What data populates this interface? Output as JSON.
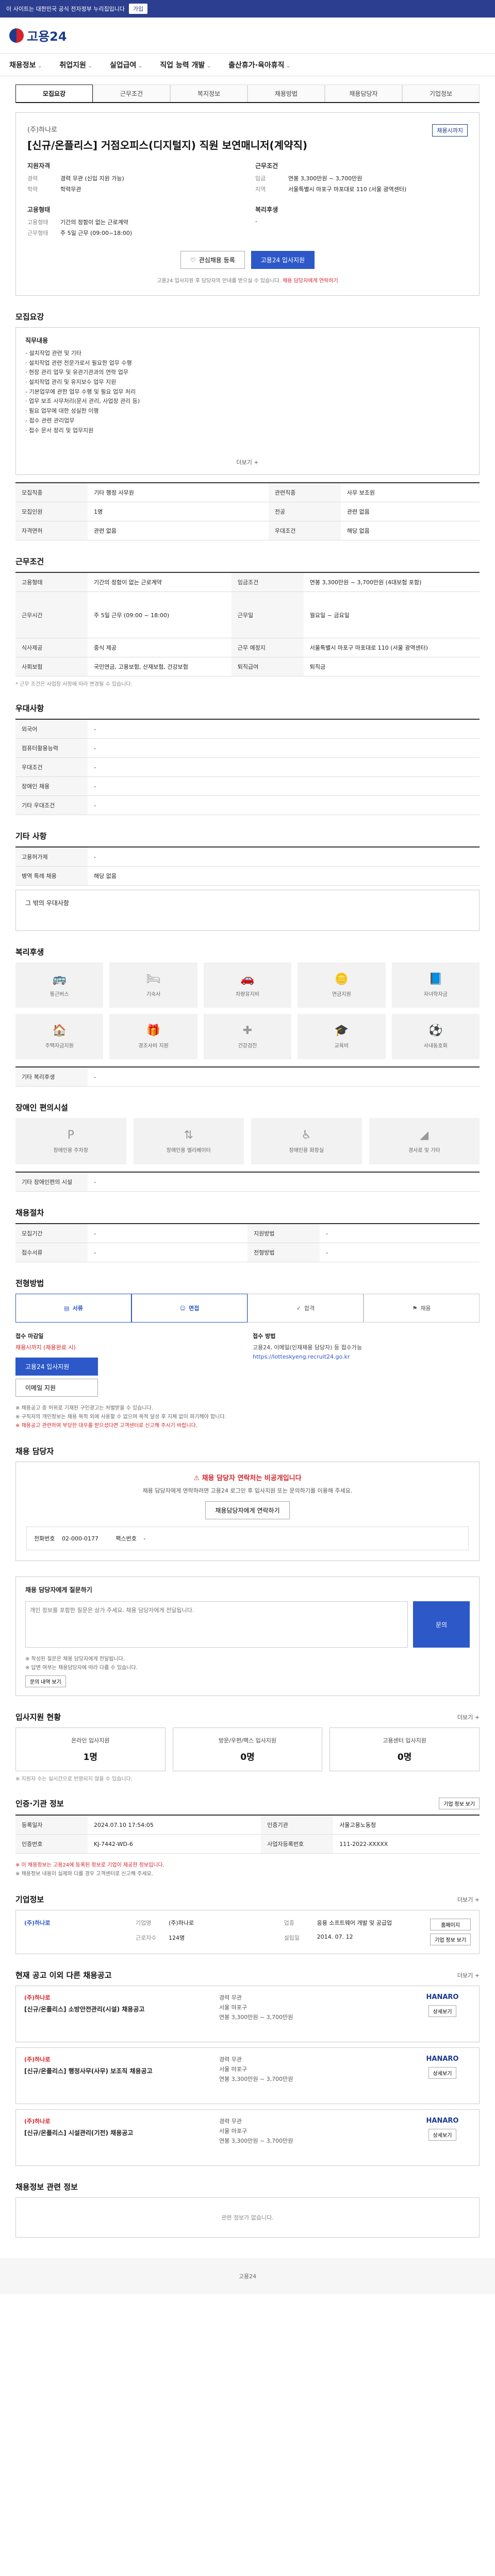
{
  "topbar": {
    "notice": "이 사이트는 대한민국 공식 전자정부 누리집입니다",
    "button": "가입"
  },
  "header": {
    "logo": "고용24"
  },
  "gnb": [
    "채용정보",
    "취업지원",
    "실업급여",
    "직업 능력 개발",
    "출산휴가·육아휴직"
  ],
  "sub_tabs": [
    "모집요강",
    "근무조건",
    "복지정보",
    "채용방법",
    "채용담당자",
    "기업정보"
  ],
  "headline": {
    "badge": "채용시까지",
    "company": "(주)하나로",
    "title": "[신규/온플리스] 거점오피스(디지털지) 직원 보연매니저(계약직)",
    "qual_title": "지원자격",
    "career_k": "경력",
    "career_v": "경력 무관 (신입 지원 가능)",
    "edu_k": "학력",
    "edu_v": "학력무관",
    "cond_title": "근무조건",
    "wage_k": "임금",
    "wage_v": "연봉 3,300만원 ~ 3,700만원",
    "region_k": "지역",
    "region_v": "서울특별시 마포구 마포대로 110 (서울 광역센터)",
    "type_title": "고용형태",
    "type_k": "고용형태",
    "type_v": "기간의 정함이 없는 근로계약",
    "hours_k": "근무형태",
    "hours_v": "주 5일 근무 (09:00~18:00)",
    "welfare_title": "복리후생",
    "welfare_v": "-",
    "btn_interest": "관심채용 등록",
    "btn_apply": "고용24 입사지원",
    "notice": "고용24 입사지원 후 담당자의 안내를 받으실 수 있습니다.",
    "notice_red": "채용 담당자에게 연락하기"
  },
  "detail": {
    "title": "모집요강",
    "heading": "직무내용",
    "body": "- 설치작업 관련 및 기타\n  · 설치작업 관련 전문가로서 필요한 업무 수행\n  · 현장 관리 업무 및 유관기관과의 연락 업무\n  · 설치작업 관리 및 유지보수 업무 지원\n- 기본업무에 관한 업무 수행 및 필요 업무 처리\n  · 업무 보조 사무처리(문서 관리, 사업장 관리 등)\n  · 필요 업무에 대한 성실한 이행\n- 접수 관련 관리업무\n  · 접수 문서 정리 및 업무지원",
    "more": "더보기 +",
    "rows": [
      {
        "k": "모집직종",
        "v": "기타 행정 사무원"
      },
      {
        "k": "관련직종",
        "v": "사무 보조원"
      },
      {
        "k": "모집인원",
        "v": "1명"
      },
      {
        "k": "전공",
        "v": "관련 없음"
      },
      {
        "k": "자격면허",
        "v": "관련 없음"
      },
      {
        "k": "우대조건",
        "v": "해당 없음"
      }
    ]
  },
  "conditions": {
    "title": "근무조건",
    "rows": [
      {
        "k": "고용형태",
        "v": "기간의 정함이 없는 근로계약"
      },
      {
        "k": "임금조건",
        "v": "연봉 3,300만원 ~ 3,700만원 (4대보험 포함)"
      },
      {
        "k": "근무시간",
        "v": "주 5일 근무 (09:00 ~ 18:00)"
      },
      {
        "k": "근무일",
        "v": "월요일 ~ 금요일"
      },
      {
        "k": "식사제공",
        "v": "중식 제공"
      },
      {
        "k": "근무 예정지",
        "v": "서울특별시 마포구 마포대로 110 (서울 광역센터)"
      },
      {
        "k": "사회보험",
        "v": "국민연금, 고용보험, 산재보험, 건강보험"
      },
      {
        "k": "퇴직급여",
        "v": "퇴직금"
      }
    ],
    "note": "* 근무 조건은 사업장 사정에 따라 변경될 수 있습니다."
  },
  "worker_info": {
    "title": "우대사항",
    "rows": [
      {
        "k": "외국어",
        "v": "-"
      },
      {
        "k": "컴퓨터활용능력",
        "v": "-"
      },
      {
        "k": "우대조건",
        "v": "-"
      },
      {
        "k": "장애인 채용",
        "v": "-"
      },
      {
        "k": "기타 우대조건",
        "v": "-"
      }
    ]
  },
  "other_info": {
    "title": "기타 사항",
    "rows": [
      {
        "k": "고용허가제",
        "v": "-"
      },
      {
        "k": "병역 특례 채용",
        "v": "해당 없음"
      }
    ],
    "extra_label": "그 밖의 우대사항"
  },
  "welfare": {
    "title": "복리후생",
    "items": [
      "통근버스",
      "기숙사",
      "차량유지비",
      "연금지원",
      "자녀학자금",
      "주택자금지원",
      "경조사비 지원",
      "건강검진",
      "교육비",
      "사내동호회"
    ],
    "etc_label": "기타 복리후생",
    "etc_value": "-"
  },
  "facility": {
    "title": "장애인 편의시설",
    "items": [
      "장애인용 주차장",
      "장애인용 엘리베이터",
      "장애인용 화장실",
      "경사로 및 기타"
    ],
    "etc_label": "기타 장애인편의 시설",
    "etc_value": "-"
  },
  "contract": {
    "title": "채용절차",
    "rows": [
      {
        "k": "모집기간",
        "v": "-"
      },
      {
        "k": "지원방법",
        "v": "-"
      },
      {
        "k": "접수서류",
        "v": "-"
      },
      {
        "k": "전형방법",
        "v": "-"
      }
    ]
  },
  "process": {
    "title": "전형방법",
    "steps": [
      "서류",
      "면접",
      "합격",
      "채용"
    ],
    "apply_label": "접수 마감일",
    "apply_value": "채용시까지 (채용완료 시)",
    "apply_btn": "고용24 입사지원",
    "apply_btn2": "이메일 지원",
    "method_label": "접수 방법",
    "method_value": "고용24, 이메일(인재채용 담당자) 등 접수가능",
    "method_link": "https://lotteskyeng.recruit24.go.kr",
    "notes": [
      "※ 채용공고 중 허위로 기재된 구인광고는 처벌받을 수 있습니다.",
      "※ 구직자의 개인정보는 채용 목적 외에 사용할 수 없으며 목적 달성 후 지체 없이 파기해야 합니다.",
      "※ 채용공고 관련하여 부당한 대우를 받으셨다면 고객센터로 신고해 주시기 바랍니다."
    ]
  },
  "contact": {
    "title": "채용 담당자",
    "warn": "채용 담당자 연락처는 비공개입니다",
    "desc": "채용 담당자에게 연락하려면 고용24 로그인 후 입사지원 또는 문의하기를 이용해 주세요.",
    "btn": "채용담당자에게 연락하기",
    "phone_label": "전화번호",
    "phone": "02-000-0177",
    "fax_label": "팩스번호",
    "fax": "-"
  },
  "inquiry": {
    "title": "채용 담당자에게 질문하기",
    "placeholder": "개인 정보를 포함한 질문은 삼가 주세요. 채용 담당자에게 전달됩니다.",
    "btn": "문의",
    "notes": [
      "※ 작성된 질문은 채용 담당자에게 전달됩니다.",
      "※ 답변 여부는 채용담당자에 따라 다를 수 있습니다."
    ],
    "note_btn": "문의 내역 보기"
  },
  "status": {
    "title": "입사지원 현황",
    "more": "더보기 +",
    "cards": [
      {
        "label": "온라인 입사지원",
        "value": "1명"
      },
      {
        "label": "방문/우편/팩스 입사지원",
        "value": "0명"
      },
      {
        "label": "고용센터 입사지원",
        "value": "0명"
      }
    ],
    "note": "※ 지원자 수는 실시간으로 반영되지 않을 수 있습니다."
  },
  "recruiter": {
    "title": "인증·기관 정보",
    "btn": "기업 정보 보기",
    "rows": [
      {
        "k1": "등록일자",
        "v1": "2024.07.10 17:54:05",
        "k2": "인증기관",
        "v2": "서울고용노동청"
      },
      {
        "k1": "인증번호",
        "v1": "KJ-7442-WD-6",
        "k2": "사업자등록번호",
        "v2": "111-2022-XXXXX"
      }
    ],
    "notes": [
      "※ 이 채용정보는 고용24에 등록된 정보로 기업이 제공한 정보입니다.",
      "※ 채용정보 내용이 실제와 다를 경우 고객센터로 신고해 주세요."
    ]
  },
  "company": {
    "title": "기업정보",
    "more": "더보기 +",
    "name": "(주)하나로",
    "rows": [
      {
        "k": "기업명",
        "v": "(주)하나로"
      },
      {
        "k": "업종",
        "v": "응용 소프트웨어 개발 및 공급업"
      },
      {
        "k": "근로자수",
        "v": "124명"
      },
      {
        "k": "설립일",
        "v": "2014. 07. 12"
      }
    ],
    "btn1": "홈페이지",
    "btn2": "기업 정보 보기"
  },
  "similar": {
    "title": "현재 공고 이외 다른 채용공고",
    "more": "더보기 +",
    "jobs": [
      {
        "co": "(주)하나로",
        "title": "[신규/온플리스] 소방안전관리(시설) 채용공고",
        "meta1": "경력 무관",
        "meta2": "서울 마포구",
        "meta3": "연봉 3,300만원 ~ 3,700만원",
        "logo": "HANARO",
        "btn": "상세보기"
      },
      {
        "co": "(주)하나로",
        "title": "[신규/온플리스] 행정사무(사무) 보조직 채용공고",
        "meta1": "경력 무관",
        "meta2": "서울 마포구",
        "meta3": "연봉 3,300만원 ~ 3,700만원",
        "logo": "HANARO",
        "btn": "상세보기"
      },
      {
        "co": "(주)하나로",
        "title": "[신규/온플리스] 시설관리(기전) 채용공고",
        "meta1": "경력 무관",
        "meta2": "서울 마포구",
        "meta3": "연봉 3,300만원 ~ 3,700만원",
        "logo": "HANARO",
        "btn": "상세보기"
      }
    ]
  },
  "related": {
    "title": "채용정보 관련 정보",
    "empty": "관련 정보가 없습니다."
  },
  "footer": {
    "text": "고용24"
  }
}
